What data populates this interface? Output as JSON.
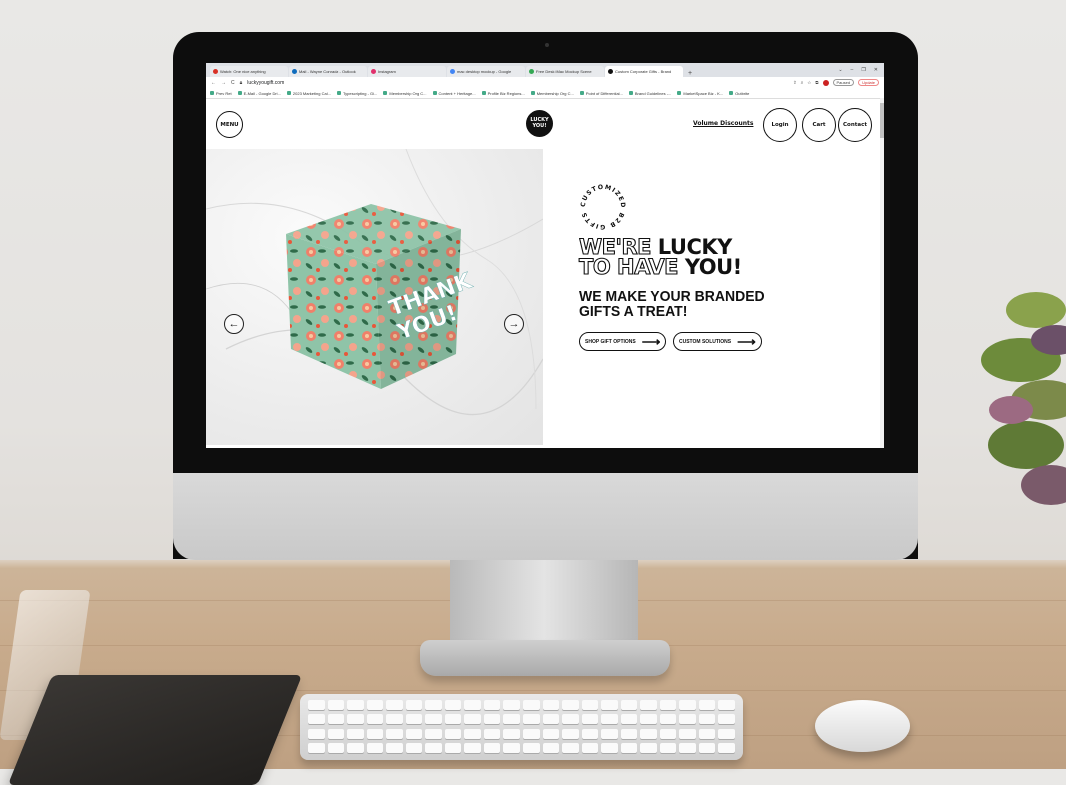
{
  "browser": {
    "tabs": [
      {
        "label": "Watch: One nice anything",
        "color": "#d93025"
      },
      {
        "label": "Mail - Wayne Conradz - Outlook",
        "color": "#0f6cbd"
      },
      {
        "label": "Instagram",
        "color": "#e1306c"
      },
      {
        "label": "mac desktop mockup - Google",
        "color": "#4285f4"
      },
      {
        "label": "Free Desk iMac Mockup Scene",
        "color": "#34a853"
      },
      {
        "label": "Custom Corporate Gifts - Brand",
        "color": "#111111"
      }
    ],
    "new_tab": "+",
    "window_controls": [
      "⌄",
      "–",
      "❐",
      "✕"
    ],
    "url": "luckyyougift.com",
    "update_label": "Update",
    "paused_label": "Paused",
    "bookmarks": [
      "Prev Ret",
      "E-Mail - Google Dri...",
      "2023 Marketing Cal...",
      "Typescripting - Gi...",
      "Membership Org C...",
      "Content + Heritage...",
      "Profile Biz Regions...",
      "Membership Org C...",
      "Point of Differential...",
      "Brand Guidelines -...",
      "MarketSpace Biz - K...",
      "Outbrite"
    ]
  },
  "site": {
    "menu_label": "MENU",
    "logo_line1": "LUCKY",
    "logo_line2": "YOU!",
    "volume_link": "Volume Discounts",
    "login_label": "Login",
    "cart_label": "Cart",
    "contact_label": "Contact"
  },
  "hero": {
    "stamp_text": "CUSTOMIZED B2B GIFTS",
    "headline_outline_1": "WE'RE",
    "headline_solid_1": "LUCKY",
    "headline_outline_2": "TO HAVE",
    "headline_solid_2": "YOU!",
    "subheading": "WE MAKE YOUR BRANDED GIFTS A TREAT!",
    "cta_shop": "SHOP GIFT OPTIONS",
    "cta_custom": "CUSTOM SOLUTIONS",
    "box_text_1": "THANK",
    "box_text_2": "YOU!",
    "prev_arrow": "←",
    "next_arrow": "→",
    "cta_arrow": "⟶"
  },
  "colors": {
    "brand_black": "#111111",
    "box_mint": "#8fc4a8",
    "flower_coral": "#f0806a"
  }
}
